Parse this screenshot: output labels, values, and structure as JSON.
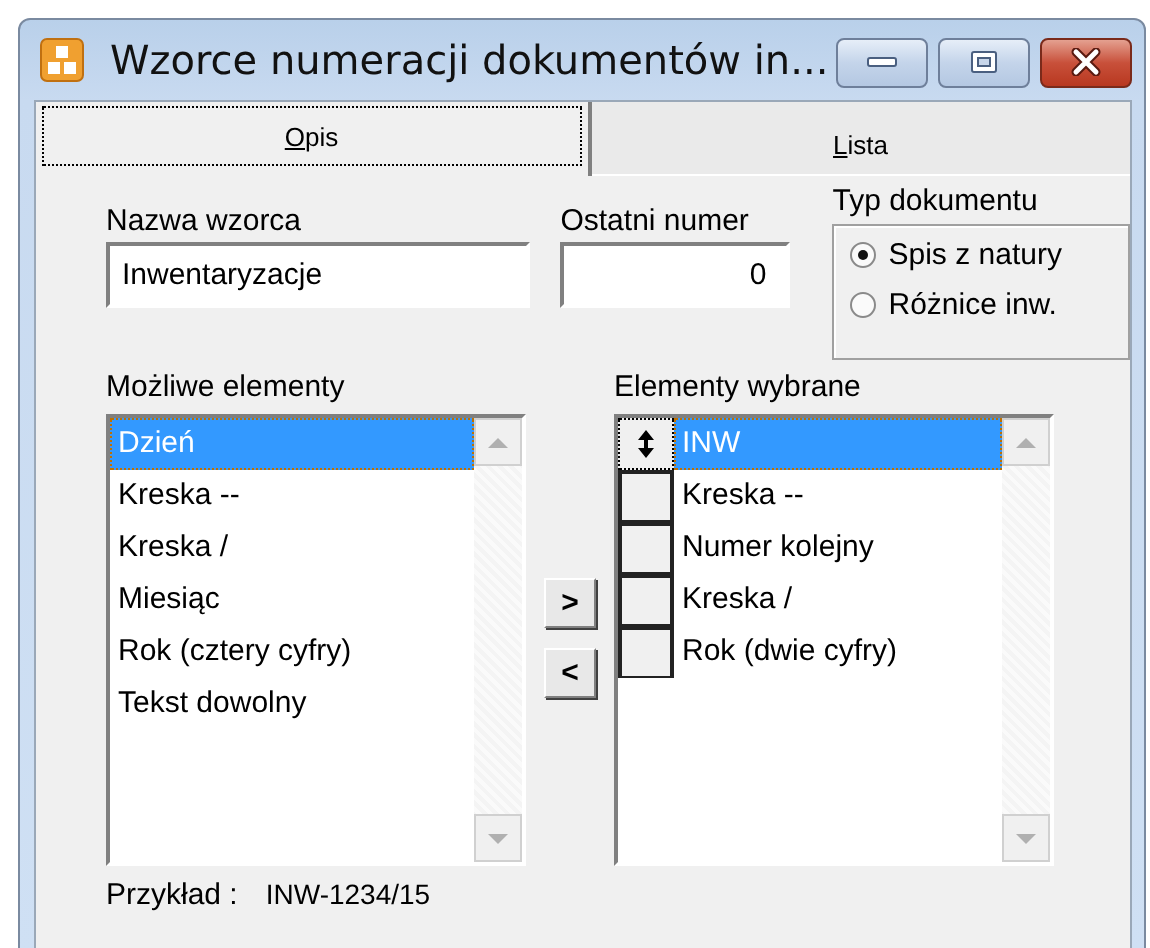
{
  "window": {
    "title": "Wzorce numeracji dokumentów in..."
  },
  "tabs": [
    {
      "label": "Opis",
      "selected": true
    },
    {
      "label": "Lista",
      "selected": false
    }
  ],
  "name_field": {
    "label": "Nazwa wzorca",
    "value": "Inwentaryzacje"
  },
  "last_number_field": {
    "label": "Ostatni numer",
    "value": "0"
  },
  "document_type": {
    "label": "Typ dokumentu",
    "options": [
      {
        "label": "Spis z natury",
        "selected": true
      },
      {
        "label": "Różnice inw.",
        "selected": false
      }
    ]
  },
  "available_elements": {
    "label": "Możliwe elementy",
    "items": [
      {
        "label": "Dzień",
        "selected": true
      },
      {
        "label": "Kreska --",
        "selected": false
      },
      {
        "label": "Kreska /",
        "selected": false
      },
      {
        "label": "Miesiąc",
        "selected": false
      },
      {
        "label": "Rok (cztery cyfry)",
        "selected": false
      },
      {
        "label": "Tekst dowolny",
        "selected": false
      }
    ]
  },
  "move_buttons": [
    ">",
    "<"
  ],
  "chosen_elements": {
    "label": "Elementy wybrane",
    "items": [
      {
        "label": "INW",
        "selected": true
      },
      {
        "label": "Kreska --",
        "selected": false
      },
      {
        "label": "Numer kolejny",
        "selected": false
      },
      {
        "label": "Kreska /",
        "selected": false
      },
      {
        "label": "Rok (dwie cyfry)",
        "selected": false
      }
    ]
  },
  "example": {
    "label": "Przykład :",
    "value": "INW-1234/15"
  }
}
